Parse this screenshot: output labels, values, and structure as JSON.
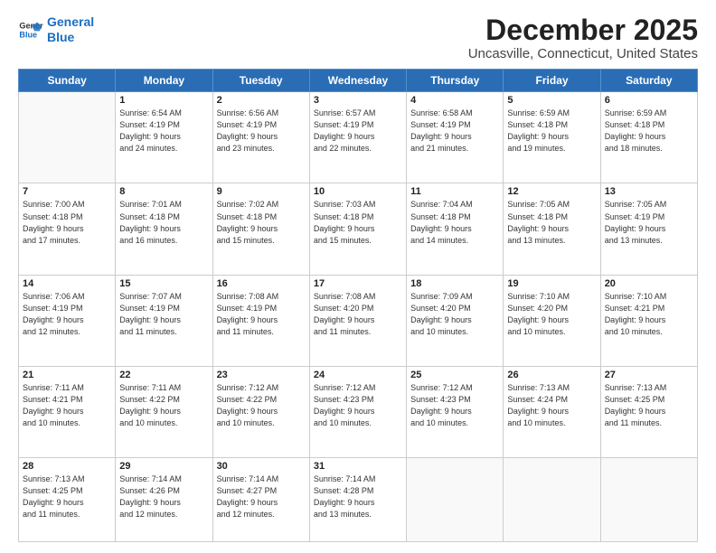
{
  "logo": {
    "line1": "General",
    "line2": "Blue"
  },
  "title": "December 2025",
  "location": "Uncasville, Connecticut, United States",
  "days_header": [
    "Sunday",
    "Monday",
    "Tuesday",
    "Wednesday",
    "Thursday",
    "Friday",
    "Saturday"
  ],
  "weeks": [
    [
      {
        "day": "",
        "info": ""
      },
      {
        "day": "1",
        "info": "Sunrise: 6:54 AM\nSunset: 4:19 PM\nDaylight: 9 hours\nand 24 minutes."
      },
      {
        "day": "2",
        "info": "Sunrise: 6:56 AM\nSunset: 4:19 PM\nDaylight: 9 hours\nand 23 minutes."
      },
      {
        "day": "3",
        "info": "Sunrise: 6:57 AM\nSunset: 4:19 PM\nDaylight: 9 hours\nand 22 minutes."
      },
      {
        "day": "4",
        "info": "Sunrise: 6:58 AM\nSunset: 4:19 PM\nDaylight: 9 hours\nand 21 minutes."
      },
      {
        "day": "5",
        "info": "Sunrise: 6:59 AM\nSunset: 4:18 PM\nDaylight: 9 hours\nand 19 minutes."
      },
      {
        "day": "6",
        "info": "Sunrise: 6:59 AM\nSunset: 4:18 PM\nDaylight: 9 hours\nand 18 minutes."
      }
    ],
    [
      {
        "day": "7",
        "info": "Sunrise: 7:00 AM\nSunset: 4:18 PM\nDaylight: 9 hours\nand 17 minutes."
      },
      {
        "day": "8",
        "info": "Sunrise: 7:01 AM\nSunset: 4:18 PM\nDaylight: 9 hours\nand 16 minutes."
      },
      {
        "day": "9",
        "info": "Sunrise: 7:02 AM\nSunset: 4:18 PM\nDaylight: 9 hours\nand 15 minutes."
      },
      {
        "day": "10",
        "info": "Sunrise: 7:03 AM\nSunset: 4:18 PM\nDaylight: 9 hours\nand 15 minutes."
      },
      {
        "day": "11",
        "info": "Sunrise: 7:04 AM\nSunset: 4:18 PM\nDaylight: 9 hours\nand 14 minutes."
      },
      {
        "day": "12",
        "info": "Sunrise: 7:05 AM\nSunset: 4:18 PM\nDaylight: 9 hours\nand 13 minutes."
      },
      {
        "day": "13",
        "info": "Sunrise: 7:05 AM\nSunset: 4:19 PM\nDaylight: 9 hours\nand 13 minutes."
      }
    ],
    [
      {
        "day": "14",
        "info": "Sunrise: 7:06 AM\nSunset: 4:19 PM\nDaylight: 9 hours\nand 12 minutes."
      },
      {
        "day": "15",
        "info": "Sunrise: 7:07 AM\nSunset: 4:19 PM\nDaylight: 9 hours\nand 11 minutes."
      },
      {
        "day": "16",
        "info": "Sunrise: 7:08 AM\nSunset: 4:19 PM\nDaylight: 9 hours\nand 11 minutes."
      },
      {
        "day": "17",
        "info": "Sunrise: 7:08 AM\nSunset: 4:20 PM\nDaylight: 9 hours\nand 11 minutes."
      },
      {
        "day": "18",
        "info": "Sunrise: 7:09 AM\nSunset: 4:20 PM\nDaylight: 9 hours\nand 10 minutes."
      },
      {
        "day": "19",
        "info": "Sunrise: 7:10 AM\nSunset: 4:20 PM\nDaylight: 9 hours\nand 10 minutes."
      },
      {
        "day": "20",
        "info": "Sunrise: 7:10 AM\nSunset: 4:21 PM\nDaylight: 9 hours\nand 10 minutes."
      }
    ],
    [
      {
        "day": "21",
        "info": "Sunrise: 7:11 AM\nSunset: 4:21 PM\nDaylight: 9 hours\nand 10 minutes."
      },
      {
        "day": "22",
        "info": "Sunrise: 7:11 AM\nSunset: 4:22 PM\nDaylight: 9 hours\nand 10 minutes."
      },
      {
        "day": "23",
        "info": "Sunrise: 7:12 AM\nSunset: 4:22 PM\nDaylight: 9 hours\nand 10 minutes."
      },
      {
        "day": "24",
        "info": "Sunrise: 7:12 AM\nSunset: 4:23 PM\nDaylight: 9 hours\nand 10 minutes."
      },
      {
        "day": "25",
        "info": "Sunrise: 7:12 AM\nSunset: 4:23 PM\nDaylight: 9 hours\nand 10 minutes."
      },
      {
        "day": "26",
        "info": "Sunrise: 7:13 AM\nSunset: 4:24 PM\nDaylight: 9 hours\nand 10 minutes."
      },
      {
        "day": "27",
        "info": "Sunrise: 7:13 AM\nSunset: 4:25 PM\nDaylight: 9 hours\nand 11 minutes."
      }
    ],
    [
      {
        "day": "28",
        "info": "Sunrise: 7:13 AM\nSunset: 4:25 PM\nDaylight: 9 hours\nand 11 minutes."
      },
      {
        "day": "29",
        "info": "Sunrise: 7:14 AM\nSunset: 4:26 PM\nDaylight: 9 hours\nand 12 minutes."
      },
      {
        "day": "30",
        "info": "Sunrise: 7:14 AM\nSunset: 4:27 PM\nDaylight: 9 hours\nand 12 minutes."
      },
      {
        "day": "31",
        "info": "Sunrise: 7:14 AM\nSunset: 4:28 PM\nDaylight: 9 hours\nand 13 minutes."
      },
      {
        "day": "",
        "info": ""
      },
      {
        "day": "",
        "info": ""
      },
      {
        "day": "",
        "info": ""
      }
    ]
  ]
}
